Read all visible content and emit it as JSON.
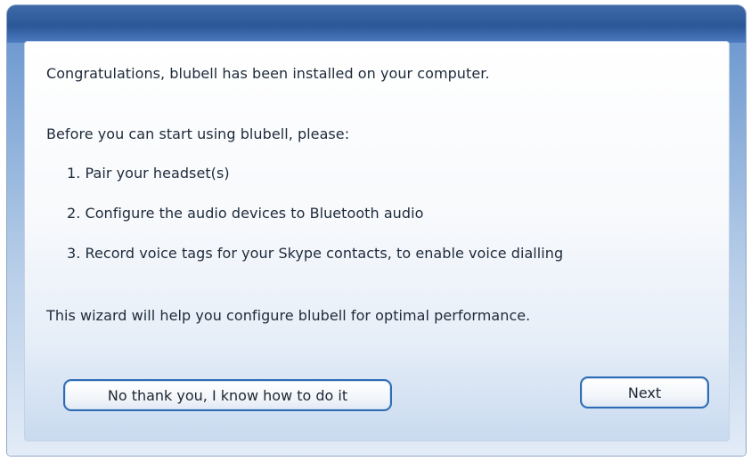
{
  "dialog": {
    "intro": "Congratulations, blubell has been installed on your computer.",
    "before_text": "Before you can start using blubell, please:",
    "steps": [
      "1. Pair your headset(s)",
      "2. Configure the audio devices to Bluetooth audio",
      "3. Record voice tags for your Skype contacts, to enable voice dialling"
    ],
    "wizard_text": "This wizard will help you configure blubell for optimal performance.",
    "buttons": {
      "decline_label": "No thank you, I know how to do it",
      "next_label": "Next"
    }
  }
}
